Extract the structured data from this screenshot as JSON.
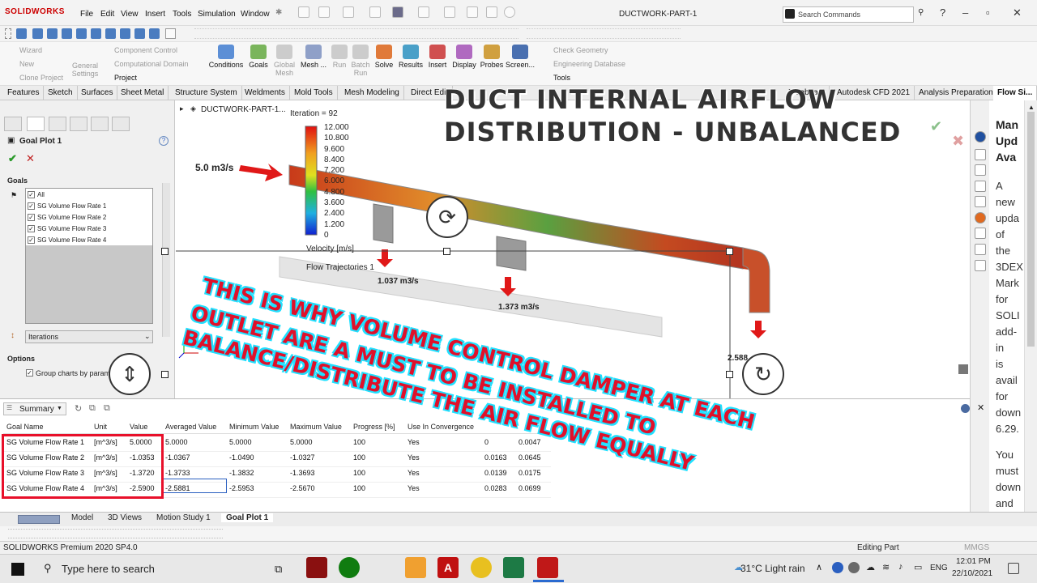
{
  "app": {
    "brand": "SOLIDWORKS",
    "menus": [
      "File",
      "Edit",
      "View",
      "Insert",
      "Tools",
      "Simulation",
      "Window"
    ],
    "document_title": "DUCTWORK-PART-1",
    "search_placeholder": "Search Commands"
  },
  "command_manager": {
    "left_items": [
      "Wizard",
      "New",
      "Clone Project",
      "General Settings"
    ],
    "project_items": [
      "Component Control",
      "Computational Domain",
      "Project"
    ],
    "buttons": [
      "Conditions",
      "Goals",
      "Global Mesh",
      "Mesh ...",
      "Run",
      "Batch Run",
      "Solve",
      "Results",
      "Insert",
      "Display",
      "Probes",
      "Screen..."
    ],
    "right_items": [
      "Check Geometry",
      "Engineering Database",
      "Tools"
    ]
  },
  "tabs": [
    "Features",
    "Sketch",
    "Surfaces",
    "Sheet Metal",
    "Structure System",
    "Weldments",
    "Mold Tools",
    "Mesh Modeling",
    "Direct Edit",
    "Bluebeam",
    "Autodesk CFD 2021",
    "Analysis Preparation",
    "Flow Si..."
  ],
  "property_manager": {
    "title": "Goal Plot 1",
    "goals_header": "Goals",
    "goals": [
      "All",
      "SG Volume Flow Rate 1",
      "SG Volume Flow Rate 2",
      "SG Volume Flow Rate 3",
      "SG Volume Flow Rate 4"
    ],
    "axis_select": "Iterations",
    "options_header": "Options",
    "options_group": "Group charts by param"
  },
  "graphics": {
    "tree_label": "DUCTWORK-PART-1...",
    "iteration": "Iteration = 92",
    "legend_values": [
      "12.000",
      "10.800",
      "9.600",
      "8.400",
      "7.200",
      "6.000",
      "4.800",
      "3.600",
      "2.400",
      "1.200",
      "0"
    ],
    "legend_title": "Velocity [m/s]",
    "trajectories_label": "Flow Trajectories 1",
    "inlet_flow": "5.0 m3/s",
    "outlet_1": "1.037 m3/s",
    "outlet_2": "1.373 m3/s",
    "outlet_3": "2.588"
  },
  "overlay": {
    "title_line1": "DUCT INTERNAL AIRFLOW",
    "title_line2": "DISTRIBUTION - UNBALANCED",
    "annotation_lines": [
      "THIS IS WHY VOLUME CONTROL DAMPER AT EACH",
      "OUTLET ARE A MUST TO BE INSTALLED TO",
      "BALANCE/DISTRIBUTE THE AIR FLOW EQUALLY"
    ]
  },
  "summary": {
    "label": "Summary",
    "columns": [
      "Goal Name",
      "Unit",
      "Value",
      "Averaged Value",
      "Minimum Value",
      "Maximum Value",
      "Progress [%]",
      "Use In Convergence",
      "",
      ""
    ],
    "rows": [
      [
        "SG Volume Flow Rate 1",
        "[m^3/s]",
        "5.0000",
        "5.0000",
        "5.0000",
        "5.0000",
        "100",
        "Yes",
        "0",
        "0.0047"
      ],
      [
        "SG Volume Flow Rate 2",
        "[m^3/s]",
        "-1.0353",
        "-1.0367",
        "-1.0490",
        "-1.0327",
        "100",
        "Yes",
        "0.0163",
        "0.0645"
      ],
      [
        "SG Volume Flow Rate 3",
        "[m^3/s]",
        "-1.3720",
        "-1.3733",
        "-1.3832",
        "-1.3693",
        "100",
        "Yes",
        "0.0139",
        "0.0175"
      ],
      [
        "SG Volume Flow Rate 4",
        "[m^3/s]",
        "-2.5900",
        "-2.5881",
        "-2.5953",
        "-2.5670",
        "100",
        "Yes",
        "0.0283",
        "0.0699"
      ]
    ]
  },
  "bottom_tabs": [
    "Model",
    "3D Views",
    "Motion Study 1",
    "Goal Plot 1"
  ],
  "status": {
    "left": "SOLIDWORKS Premium 2020 SP4.0",
    "editing": "Editing Part",
    "units": "MMGS"
  },
  "news_panel": {
    "heading": [
      "Man",
      "Upd",
      "Ava"
    ],
    "body": [
      "A",
      "new",
      "upda",
      "of",
      "the",
      "3DEX",
      "Mark",
      "for",
      "SOLI",
      "add-",
      "in",
      "is",
      "avail",
      "for",
      "down",
      "6.29.",
      "",
      "You",
      "must",
      "down",
      "and"
    ]
  },
  "taskbar": {
    "search_placeholder": "Type here to search",
    "weather": "31°C  Light rain",
    "lang": "ENG",
    "time": "12:01 PM",
    "date": "22/10/2021"
  },
  "colors": {
    "accent_red": "#e0102a",
    "overlay_cyan": "#20e0ff",
    "highlight_box": "#e8102a"
  }
}
